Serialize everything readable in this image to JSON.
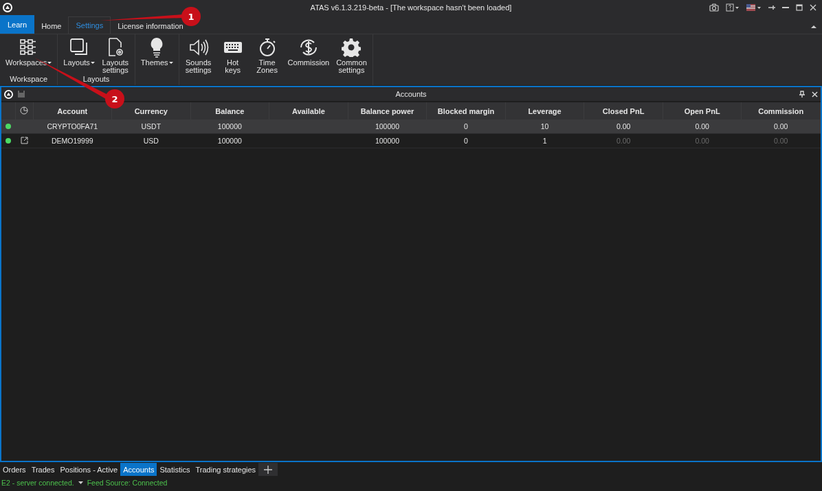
{
  "window": {
    "title": "ATAS v6.1.3.219-beta - [The workspace hasn't been loaded]"
  },
  "ribbon_tabs": [
    {
      "label": "Learn",
      "kind": "learn",
      "selected": false
    },
    {
      "label": "Home",
      "kind": "tab",
      "selected": false
    },
    {
      "label": "Settings",
      "kind": "tab",
      "selected": true
    },
    {
      "label": "License information",
      "kind": "tab",
      "selected": false
    }
  ],
  "ribbon_groups": [
    {
      "label": "Workspace",
      "items": [
        {
          "label": "Workspaces",
          "kind": "grid",
          "dropdown": true
        }
      ]
    },
    {
      "label": "Layouts",
      "items": [
        {
          "label": "Layouts",
          "kind": "copy",
          "dropdown": true
        },
        {
          "label": "Layouts\nsettings",
          "kind": "docgear",
          "dropdown": false
        }
      ]
    },
    {
      "items": [
        {
          "label": "Themes",
          "kind": "bulb",
          "dropdown": true
        }
      ]
    },
    {
      "items": [
        {
          "label": "Sounds\nsettings",
          "kind": "speaker",
          "dropdown": false
        },
        {
          "label": "Hot\nkeys",
          "kind": "keyboard",
          "dropdown": false
        },
        {
          "label": "Time\nZones",
          "kind": "stopwatch",
          "dropdown": false
        },
        {
          "label": "Commission",
          "kind": "dollar",
          "dropdown": false
        },
        {
          "label": "Common\nsettings",
          "kind": "gear",
          "dropdown": false
        }
      ]
    }
  ],
  "panel": {
    "title": "Accounts",
    "table": {
      "columns": [
        "Account",
        "Currency",
        "Balance",
        "Available",
        "Balance power",
        "Blocked margin",
        "Leverage",
        "Closed PnL",
        "Open PnL",
        "Commission"
      ],
      "rows": [
        {
          "selected": true,
          "color": "#4cd964",
          "external_link": false,
          "cells": [
            "CRYPTO0FA71",
            "USDT",
            "100000",
            "",
            "100000",
            "0",
            "10",
            "0.00",
            "0.00",
            "0.00"
          ],
          "pnl_dimmed": false
        },
        {
          "selected": false,
          "color": "#4cd964",
          "external_link": true,
          "cells": [
            "DEMO19999",
            "USD",
            "100000",
            "",
            "100000",
            "0",
            "1",
            "0.00",
            "0.00",
            "0.00"
          ],
          "pnl_dimmed": true
        }
      ]
    }
  },
  "bottom_tabs": [
    {
      "label": "Orders",
      "selected": false
    },
    {
      "label": "Trades",
      "selected": false
    },
    {
      "label": "Positions - Active",
      "selected": false
    },
    {
      "label": "Accounts",
      "selected": true
    },
    {
      "label": "Statistics",
      "selected": false
    },
    {
      "label": "Trading strategies",
      "selected": false
    }
  ],
  "status_bar": {
    "connection": "E2 - server connected.",
    "feed": "Feed Source: Connected"
  },
  "annotations": [
    {
      "number": "1"
    },
    {
      "number": "2"
    }
  ]
}
